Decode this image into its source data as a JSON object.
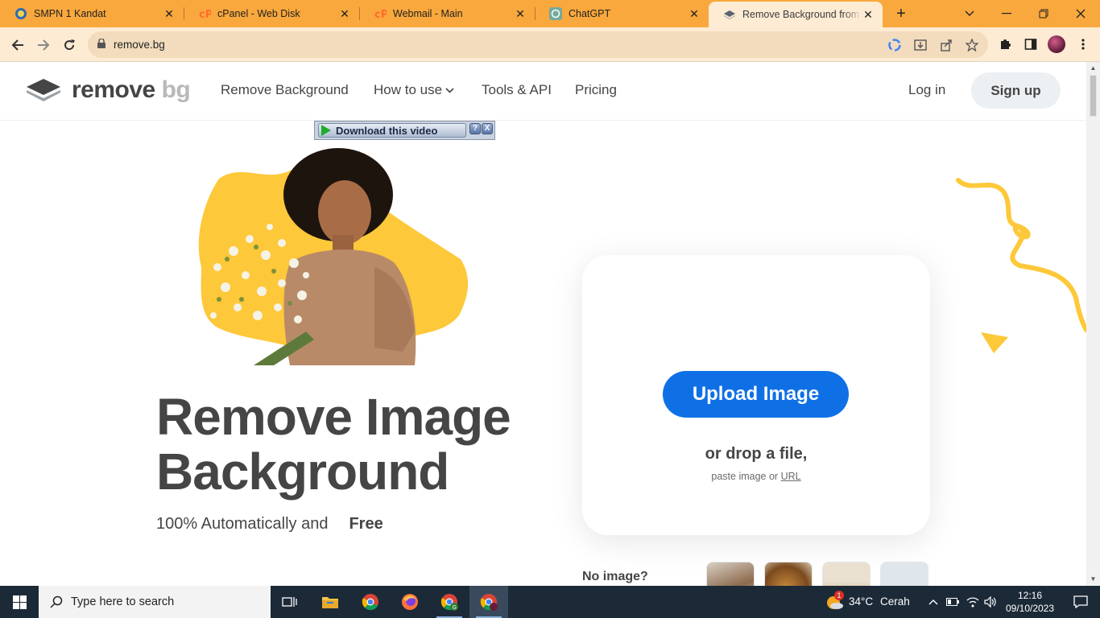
{
  "browser": {
    "tabs": [
      {
        "title": "SMPN 1 Kandat",
        "icon": "school-favicon"
      },
      {
        "title": "cPanel - Web Disk",
        "icon": "cpanel-favicon"
      },
      {
        "title": "Webmail - Main",
        "icon": "cpanel-favicon"
      },
      {
        "title": "ChatGPT",
        "icon": "chatgpt-favicon"
      },
      {
        "title": "Remove Background from Im",
        "icon": "removebg-favicon",
        "active": true
      }
    ],
    "url": "remove.bg",
    "tab_close": "✕",
    "new_tab": "+"
  },
  "site": {
    "logo_text_main": "remove",
    "logo_text_accent": "bg",
    "nav": [
      "Remove Background",
      "How to use",
      "Tools & API",
      "Pricing"
    ],
    "login": "Log in",
    "signup": "Sign up"
  },
  "download_bar": {
    "label": "Download this video",
    "help": "?",
    "close": "X"
  },
  "hero": {
    "title_line1": "Remove Image",
    "title_line2": "Background",
    "subtitle": "100% Automatically and",
    "highlight": "Free"
  },
  "upload": {
    "button": "Upload Image",
    "drop_text": "or drop a file,",
    "paste_text": "paste image or",
    "url_link": "URL"
  },
  "samples": {
    "label": "No image?"
  },
  "taskbar": {
    "search_placeholder": "Type here to search",
    "weather_temp": "34°C",
    "weather_desc": "Cerah",
    "weather_badge": "1",
    "time": "12:16",
    "date": "09/10/2023"
  },
  "colors": {
    "tabstrip": "#f9a83d",
    "toolbar": "#fdebd3",
    "upload_button": "#0f70e6",
    "accent_yellow": "#fdc839",
    "text": "#454545"
  }
}
